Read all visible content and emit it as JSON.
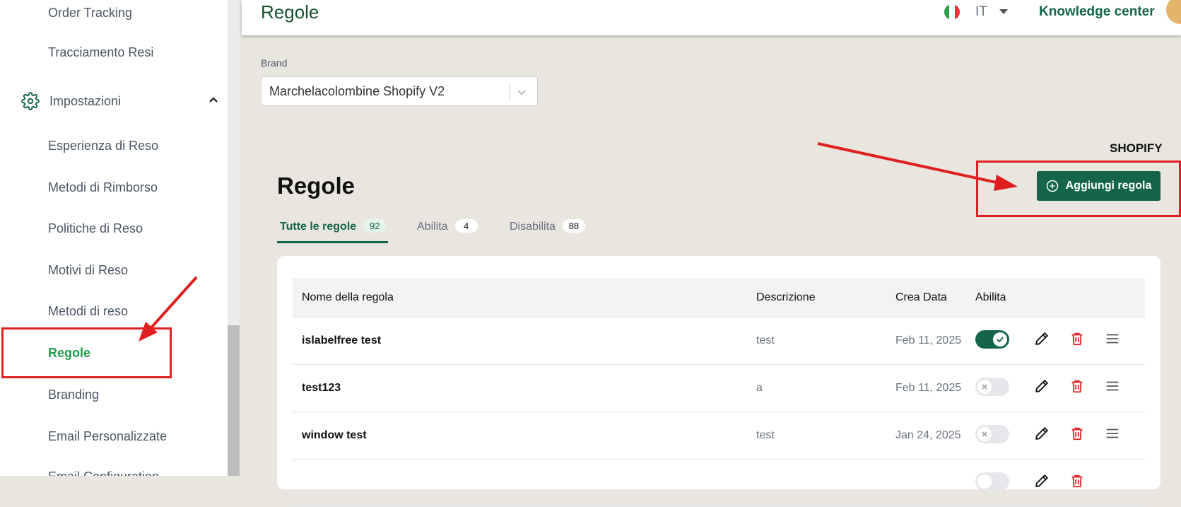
{
  "sidebar": {
    "items": {
      "order_tracking": "Order Tracking",
      "returns_tracking": "Tracciamento Resi",
      "settings": "Impostazioni",
      "return_experience": "Esperienza di Reso",
      "refund_methods": "Metodi di Rimborso",
      "return_policies": "Politiche di Reso",
      "return_reasons": "Motivi di Reso",
      "return_methods": "Metodi di reso",
      "rules": "Regole",
      "branding": "Branding",
      "custom_emails": "Email Personalizzate",
      "email_configuration": "Email Configuration"
    }
  },
  "header": {
    "title": "Regole",
    "language": "IT",
    "knowledge_center": "Knowledge center"
  },
  "brand": {
    "label": "Brand",
    "selected": "Marchelacolombine Shopify V2"
  },
  "platform": "SHOPIFY",
  "section_title": "Regole",
  "add_button": "Aggiungi regola",
  "tabs": [
    {
      "label": "Tutte le regole",
      "count": "92"
    },
    {
      "label": "Abilita",
      "count": "4"
    },
    {
      "label": "Disabilita",
      "count": "88"
    }
  ],
  "table": {
    "columns": {
      "name": "Nome della regola",
      "description": "Descrizione",
      "date": "Crea Data",
      "enabled": "Abilita"
    },
    "rows": [
      {
        "name": "islabelfree test",
        "description": "test",
        "date": "Feb 11, 2025",
        "enabled": true
      },
      {
        "name": "test123",
        "description": "a",
        "date": "Feb 11, 2025",
        "enabled": false
      },
      {
        "name": "window test",
        "description": "test",
        "date": "Jan 24, 2025",
        "enabled": false
      }
    ]
  },
  "colors": {
    "primary": "#14654a",
    "active_nav": "#1f9d4c",
    "annotation": "#e02020",
    "delete": "#dc2626"
  }
}
